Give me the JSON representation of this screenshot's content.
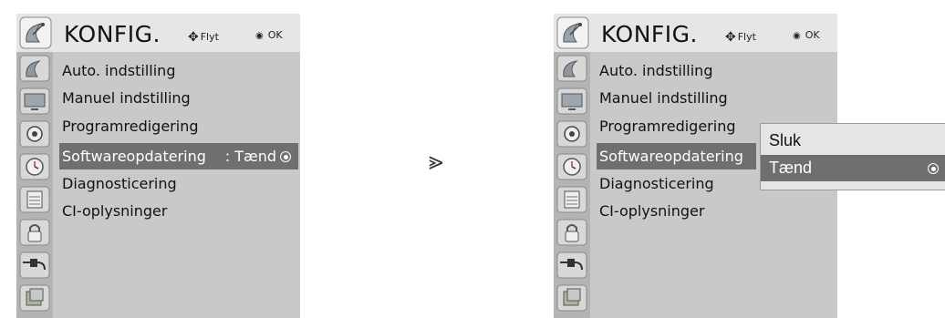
{
  "left_screen": {
    "title": "KONFIG.",
    "hint_move": "Flyt",
    "hint_ok": "OK",
    "menu_items": [
      {
        "label": "Auto. indstilling"
      },
      {
        "label": "Manuel indstilling"
      },
      {
        "label": "Programredigering"
      },
      {
        "label": "Softwareopdatering",
        "value": ": Tænd"
      },
      {
        "label": "Diagnosticering"
      },
      {
        "label": "CI-oplysninger"
      }
    ],
    "sidebar_icons": [
      "satellite-dish-icon",
      "tv-screen-icon",
      "speaker-icon",
      "clock-icon",
      "calendar-icon",
      "padlock-icon",
      "plug-icon",
      "photo-icon"
    ]
  },
  "transition_arrow": "⪢",
  "right_screen": {
    "title": "KONFIG.",
    "hint_move": "Flyt",
    "hint_ok": "OK",
    "menu_items": [
      {
        "label": "Auto. indstilling"
      },
      {
        "label": "Manuel indstilling"
      },
      {
        "label": "Programredigering"
      },
      {
        "label": "Softwareopdatering"
      },
      {
        "label": "Diagnosticering"
      },
      {
        "label": "CI-oplysninger"
      }
    ],
    "popup_options": [
      {
        "label": "Sluk",
        "selected": false
      },
      {
        "label": "Tænd",
        "selected": true
      }
    ]
  },
  "colors": {
    "panel_bg": "#c9c9c9",
    "header_bg": "#e6e6e6",
    "sidebar_bg": "#b4b4b4",
    "highlight": "#6f6f6f"
  }
}
